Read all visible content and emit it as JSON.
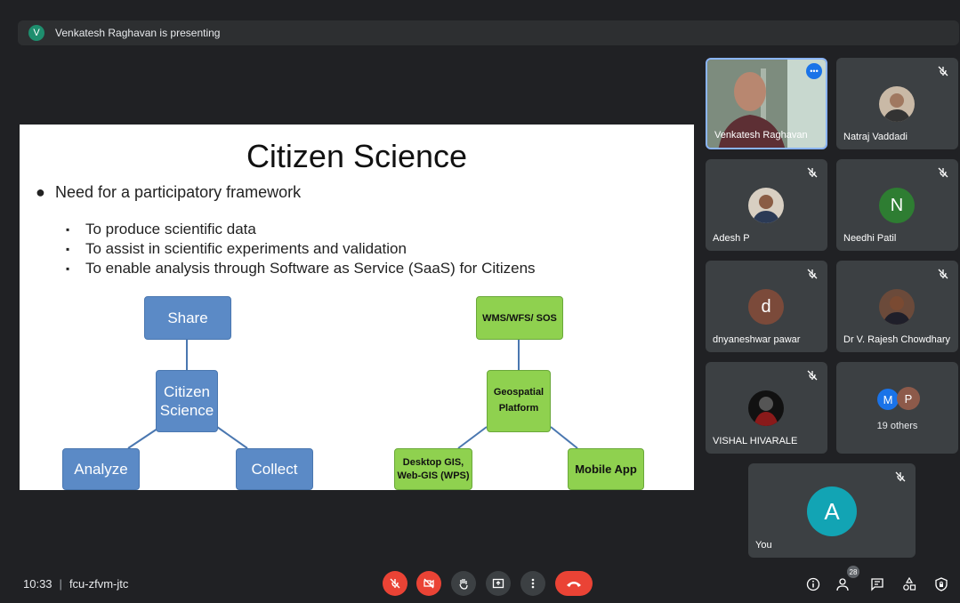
{
  "banner": {
    "avatar_letter": "V",
    "text": "Venkatesh Raghavan is presenting"
  },
  "slide": {
    "title": "Citizen Science",
    "bullet": "Need for a participatory framework",
    "subbullets": [
      "To produce scientific data",
      "To assist in scientific experiments and validation",
      "To enable analysis through Software as Service (SaaS) for Citizens"
    ],
    "left_diagram": {
      "top": "Share",
      "center": "Citizen Science",
      "left": "Analyze",
      "right": "Collect"
    },
    "right_diagram": {
      "top": "WMS/WFS/ SOS",
      "center": "Geospatial Platform",
      "left": "Desktop GIS, Web-GIS (WPS)",
      "right": "Mobile App"
    }
  },
  "participants": [
    {
      "name": "Venkatesh Raghavan",
      "type": "video",
      "speaking": true
    },
    {
      "name": "Natraj Vaddadi",
      "type": "photo",
      "muted": true
    },
    {
      "name": "Adesh P",
      "type": "photo",
      "muted": true
    },
    {
      "name": "Needhi Patil",
      "type": "letter",
      "letter": "N",
      "color": "#2e7d32",
      "muted": true
    },
    {
      "name": "dnyaneshwar pawar",
      "type": "letter",
      "letter": "d",
      "color": "#7b4a3a",
      "muted": true
    },
    {
      "name": "Dr V. Rajesh Chowdhary",
      "type": "photo",
      "muted": true
    },
    {
      "name": "VISHAL HIVARALE",
      "type": "photo",
      "muted": true
    },
    {
      "name": "19 others",
      "type": "group",
      "letters": [
        "M",
        "P"
      ],
      "colors": [
        "#1a73e8",
        "#8d5a4a"
      ]
    }
  ],
  "self_tile": {
    "name": "You",
    "letter": "A",
    "color": "#12a4b4"
  },
  "footer": {
    "time": "10:33",
    "separator": "|",
    "meeting_code": "fcu-zfvm-jtc",
    "people_count": "28"
  }
}
